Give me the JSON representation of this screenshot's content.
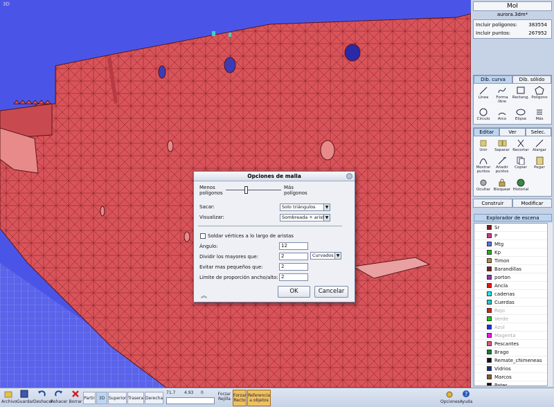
{
  "viewport": {
    "label": "3D"
  },
  "header": {
    "app_name": "MoI",
    "file_name": "aurora.3dm*"
  },
  "stats": {
    "polygons_label": "Incluir polígonos:",
    "polygons_value": "383554",
    "points_label": "Incluir puntos:",
    "points_value": "267952"
  },
  "draw_tabs": {
    "curve": "Dib. curva",
    "solid": "Dib. sólido"
  },
  "draw_tools": [
    {
      "label": "Línea",
      "icon": "line-icon"
    },
    {
      "label": "Forma libre",
      "icon": "freeform-icon"
    },
    {
      "label": "Rectang.",
      "icon": "rectangle-icon"
    },
    {
      "label": "Polígono",
      "icon": "polygon-icon"
    },
    {
      "label": "Círculo",
      "icon": "circle-icon"
    },
    {
      "label": "Arco",
      "icon": "arc-icon"
    },
    {
      "label": "Elipse",
      "icon": "ellipse-icon"
    },
    {
      "label": "Más",
      "icon": "more-icon"
    }
  ],
  "edit_tabs": {
    "edit": "Editar",
    "view": "Ver",
    "select": "Selec."
  },
  "edit_tools": [
    {
      "label": "Unir",
      "icon": "join-icon"
    },
    {
      "label": "Separar",
      "icon": "separate-icon"
    },
    {
      "label": "Recortar",
      "icon": "trim-icon"
    },
    {
      "label": "Alargar",
      "icon": "extend-icon"
    },
    {
      "label": "Mostrar puntos",
      "icon": "show-points-icon"
    },
    {
      "label": "Añadir puntos",
      "icon": "add-points-icon"
    },
    {
      "label": "Copiar",
      "icon": "copy-icon"
    },
    {
      "label": "Pegar",
      "icon": "paste-icon"
    },
    {
      "label": "Ocultar",
      "icon": "hide-icon"
    },
    {
      "label": "Bloquear",
      "icon": "lock-icon"
    },
    {
      "label": "Historial",
      "icon": "history-icon"
    }
  ],
  "actions": {
    "construct": "Construir",
    "modify": "Modificar"
  },
  "scene": {
    "title": "Explorador de escena",
    "items": [
      {
        "name": "Sr",
        "color": "#7a1f1f",
        "dim": false
      },
      {
        "name": "P",
        "color": "#c83a8c",
        "dim": false
      },
      {
        "name": "Mtg",
        "color": "#5f6fe0",
        "dim": false
      },
      {
        "name": "Kp",
        "color": "#16b816",
        "dim": false
      },
      {
        "name": "Timon",
        "color": "#b48a3c",
        "dim": false
      },
      {
        "name": "Barandillas",
        "color": "#7a2020",
        "dim": false
      },
      {
        "name": "porton",
        "color": "#8a3aa8",
        "dim": false
      },
      {
        "name": "Ancla",
        "color": "#e01818",
        "dim": false
      },
      {
        "name": "cadenas",
        "color": "#22e8e8",
        "dim": false
      },
      {
        "name": "Cuerdas",
        "color": "#20c8c8",
        "dim": false
      },
      {
        "name": "Rojo",
        "color": "#e81818",
        "dim": true
      },
      {
        "name": "Verde",
        "color": "#18c818",
        "dim": true
      },
      {
        "name": "Azul",
        "color": "#2030e8",
        "dim": true
      },
      {
        "name": "Magenta",
        "color": "#e818e8",
        "dim": true
      },
      {
        "name": "Pescantes",
        "color": "#d85a8a",
        "dim": false
      },
      {
        "name": "Brago",
        "color": "#1a7a2a",
        "dim": false
      },
      {
        "name": "Remate_chimeneas",
        "color": "#111111",
        "dim": false
      },
      {
        "name": "Vidrios",
        "color": "#1a2a7a",
        "dim": false
      },
      {
        "name": "Marcos",
        "color": "#8a5a20",
        "dim": false
      },
      {
        "name": "Pates",
        "color": "#111111",
        "dim": false
      }
    ]
  },
  "dialog": {
    "title": "Opciones de malla",
    "less_polygons": "Menos polígonos",
    "more_polygons": "Más polígonos",
    "slider_value": 0.36,
    "output_label": "Sacar:",
    "output_value": "Solo triángulos",
    "display_label": "Visualizar:",
    "display_value": "Sombreada + aristas",
    "weld_label": "Soldar vértices a lo largo de aristas",
    "weld_checked": false,
    "angle_label": "Ángulo:",
    "angle_value": "12",
    "divide_label": "Dividir los mayores que:",
    "divide_value": "2",
    "divide_mode": "Curvados",
    "avoid_label": "Evitar mas pequeños que:",
    "avoid_value": "2",
    "ratio_label": "Límite de proporción ancho/alto:",
    "ratio_value": "2",
    "ok": "OK",
    "cancel": "Cancelar"
  },
  "bottom": {
    "file": "Archivo",
    "save": "Guardar",
    "undo": "Deshacer",
    "redo": "Rehacer",
    "delete": "Borrar",
    "split": "Partir",
    "v3d": "3D",
    "top": "Superior",
    "back": "Trasera",
    "right": "Derecha",
    "coord_x": "71.7",
    "coord_y": "4.93",
    "coord_z": "0",
    "force_grid": "Forzar Rejilla",
    "force_straight": "Forzar Recto",
    "object_ref": "Referencia a objetos",
    "options": "Opciones",
    "help": "Ayuda"
  }
}
